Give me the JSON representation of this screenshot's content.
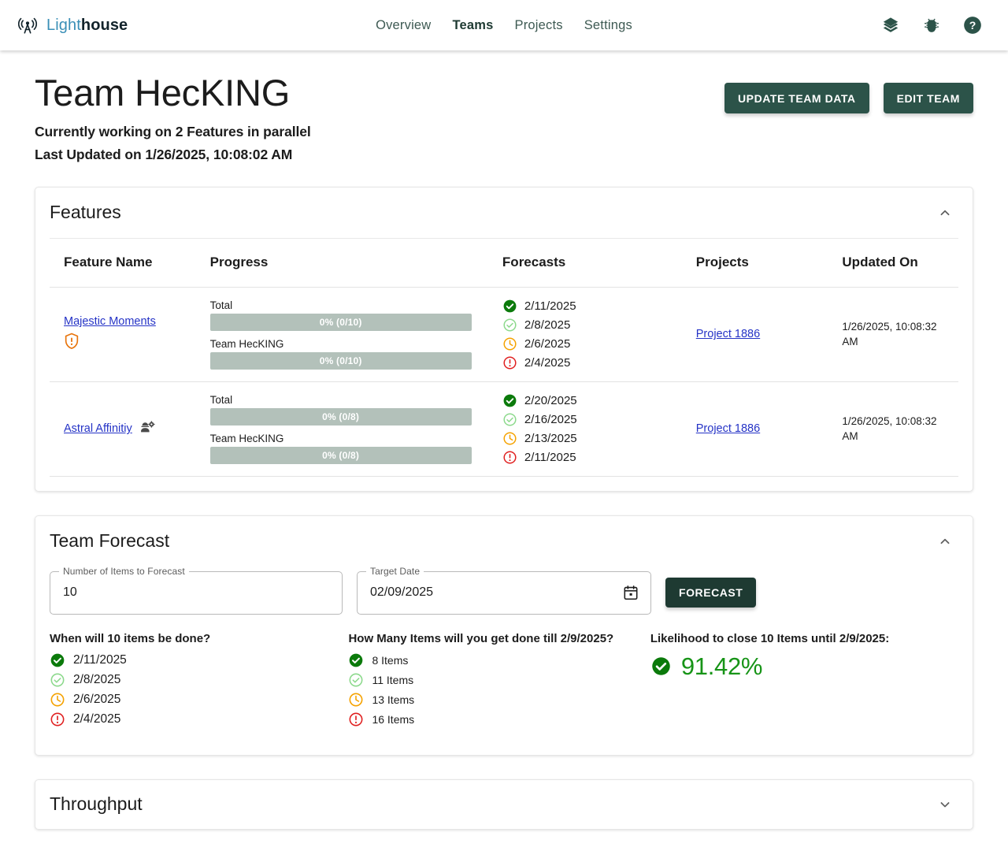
{
  "app": {
    "brand_light": "Light",
    "brand_bold": "house",
    "logo_icon": "broadcast-tower-icon"
  },
  "nav": {
    "items": [
      {
        "label": "Overview",
        "active": false
      },
      {
        "label": "Teams",
        "active": true
      },
      {
        "label": "Projects",
        "active": false
      },
      {
        "label": "Settings",
        "active": false
      }
    ],
    "icons": [
      {
        "name": "stack-layers-icon"
      },
      {
        "name": "bug-icon"
      },
      {
        "name": "help-circle-icon"
      }
    ]
  },
  "header": {
    "title": "Team HecKING",
    "subtitle": "Currently working on 2 Features in parallel",
    "last_updated": "Last Updated on 1/26/2025, 10:08:02 AM",
    "update_button": "UPDATE TEAM DATA",
    "edit_button": "EDIT TEAM"
  },
  "features_card": {
    "title": "Features",
    "expanded": true,
    "columns": [
      "Feature Name",
      "Progress",
      "Forecasts",
      "Projects",
      "Updated On"
    ],
    "rows": [
      {
        "name": "Majestic Moments",
        "name_icon": "shield-warning-icon",
        "progress": [
          {
            "label": "Total",
            "text": "0% (0/10)",
            "percent": 0
          },
          {
            "label": "Team HecKING",
            "text": "0% (0/10)",
            "percent": 0
          }
        ],
        "forecasts": [
          {
            "icon": "check-filled-icon",
            "value": "2/11/2025"
          },
          {
            "icon": "check-outline-icon",
            "value": "2/8/2025"
          },
          {
            "icon": "clock-icon",
            "value": "2/6/2025"
          },
          {
            "icon": "alert-icon",
            "value": "2/4/2025"
          }
        ],
        "project": "Project 1886",
        "updated_on": "1/26/2025, 10:08:32 AM"
      },
      {
        "name": "Astral Affinitiy",
        "name_icon": "engineer-gear-icon",
        "progress": [
          {
            "label": "Total",
            "text": "0% (0/8)",
            "percent": 0
          },
          {
            "label": "Team HecKING",
            "text": "0% (0/8)",
            "percent": 0
          }
        ],
        "forecasts": [
          {
            "icon": "check-filled-icon",
            "value": "2/20/2025"
          },
          {
            "icon": "check-outline-icon",
            "value": "2/16/2025"
          },
          {
            "icon": "clock-icon",
            "value": "2/13/2025"
          },
          {
            "icon": "alert-icon",
            "value": "2/11/2025"
          }
        ],
        "project": "Project 1886",
        "updated_on": "1/26/2025, 10:08:32 AM"
      }
    ]
  },
  "forecast_card": {
    "title": "Team Forecast",
    "expanded": true,
    "items_field": {
      "legend": "Number of Items to Forecast",
      "value": "10"
    },
    "date_field": {
      "legend": "Target Date",
      "value": "02/09/2025",
      "icon": "calendar-icon"
    },
    "forecast_button": "FORECAST",
    "when_done": {
      "heading": "When will 10 items be done?",
      "rows": [
        {
          "icon": "check-filled-icon",
          "value": "2/11/2025"
        },
        {
          "icon": "check-outline-icon",
          "value": "2/8/2025"
        },
        {
          "icon": "clock-icon",
          "value": "2/6/2025"
        },
        {
          "icon": "alert-icon",
          "value": "2/4/2025"
        }
      ]
    },
    "how_many": {
      "heading": "How Many Items will you get done till 2/9/2025?",
      "rows": [
        {
          "icon": "check-filled-icon",
          "value": "8 Items"
        },
        {
          "icon": "check-outline-icon",
          "value": "11 Items"
        },
        {
          "icon": "clock-icon",
          "value": "13 Items"
        },
        {
          "icon": "alert-icon",
          "value": "16 Items"
        }
      ]
    },
    "likelihood": {
      "heading": "Likelihood to close 10 Items until 2/9/2025:",
      "icon": "check-filled-icon",
      "value": "91.42%"
    }
  },
  "throughput_card": {
    "title": "Throughput",
    "expanded": false
  },
  "colors": {
    "brand_dark_green": "#2c5349",
    "button_dark_green": "#1e3a32",
    "link_blue": "#2533c6",
    "progress_bar": "#b3c1ba",
    "check_filled": "#0b7a0b",
    "check_outline": "#8cd98c",
    "clock_orange": "#f5a200",
    "alert_red": "#e02020",
    "percent_green": "#179417",
    "shield_orange": "#e8740c"
  }
}
